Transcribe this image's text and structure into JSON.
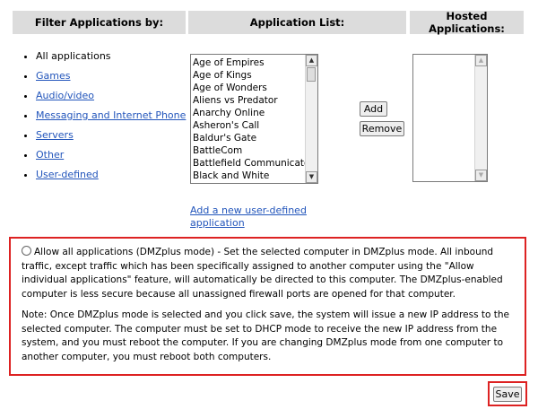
{
  "headers": {
    "filter": "Filter Applications by:",
    "list": "Application List:",
    "hosted": "Hosted Applications:"
  },
  "filters": {
    "all": "All applications",
    "games": "Games",
    "audio": "Audio/video",
    "messaging": "Messaging and Internet Phone",
    "servers": "Servers",
    "other": "Other",
    "user": "User-defined"
  },
  "applications": [
    "Age of Empires",
    "Age of Kings",
    "Age of Wonders",
    "Aliens vs Predator",
    "Anarchy Online",
    "Asheron's Call",
    "Baldur's Gate",
    "BattleCom",
    "Battlefield Communicator",
    "Black and White"
  ],
  "buttons": {
    "add": "Add",
    "remove": "Remove",
    "save": "Save"
  },
  "add_link": "Add a new user-defined application",
  "dmz": {
    "radio_text": "Allow all applications (DMZplus mode) - Set the selected computer in DMZplus mode. All inbound traffic, except traffic which has been specifically assigned to another computer using the \"Allow individual applications\" feature, will automatically be directed to this computer. The DMZplus-enabled computer is less secure because all unassigned firewall ports are opened for that computer.",
    "note": "Note: Once DMZplus mode is selected and you click save, the system will issue a new IP address to the selected computer. The computer must be set to DHCP mode to receive the new IP address from the system, and you must reboot the computer. If you are changing DMZplus mode from one computer to another computer, you must reboot both computers."
  }
}
